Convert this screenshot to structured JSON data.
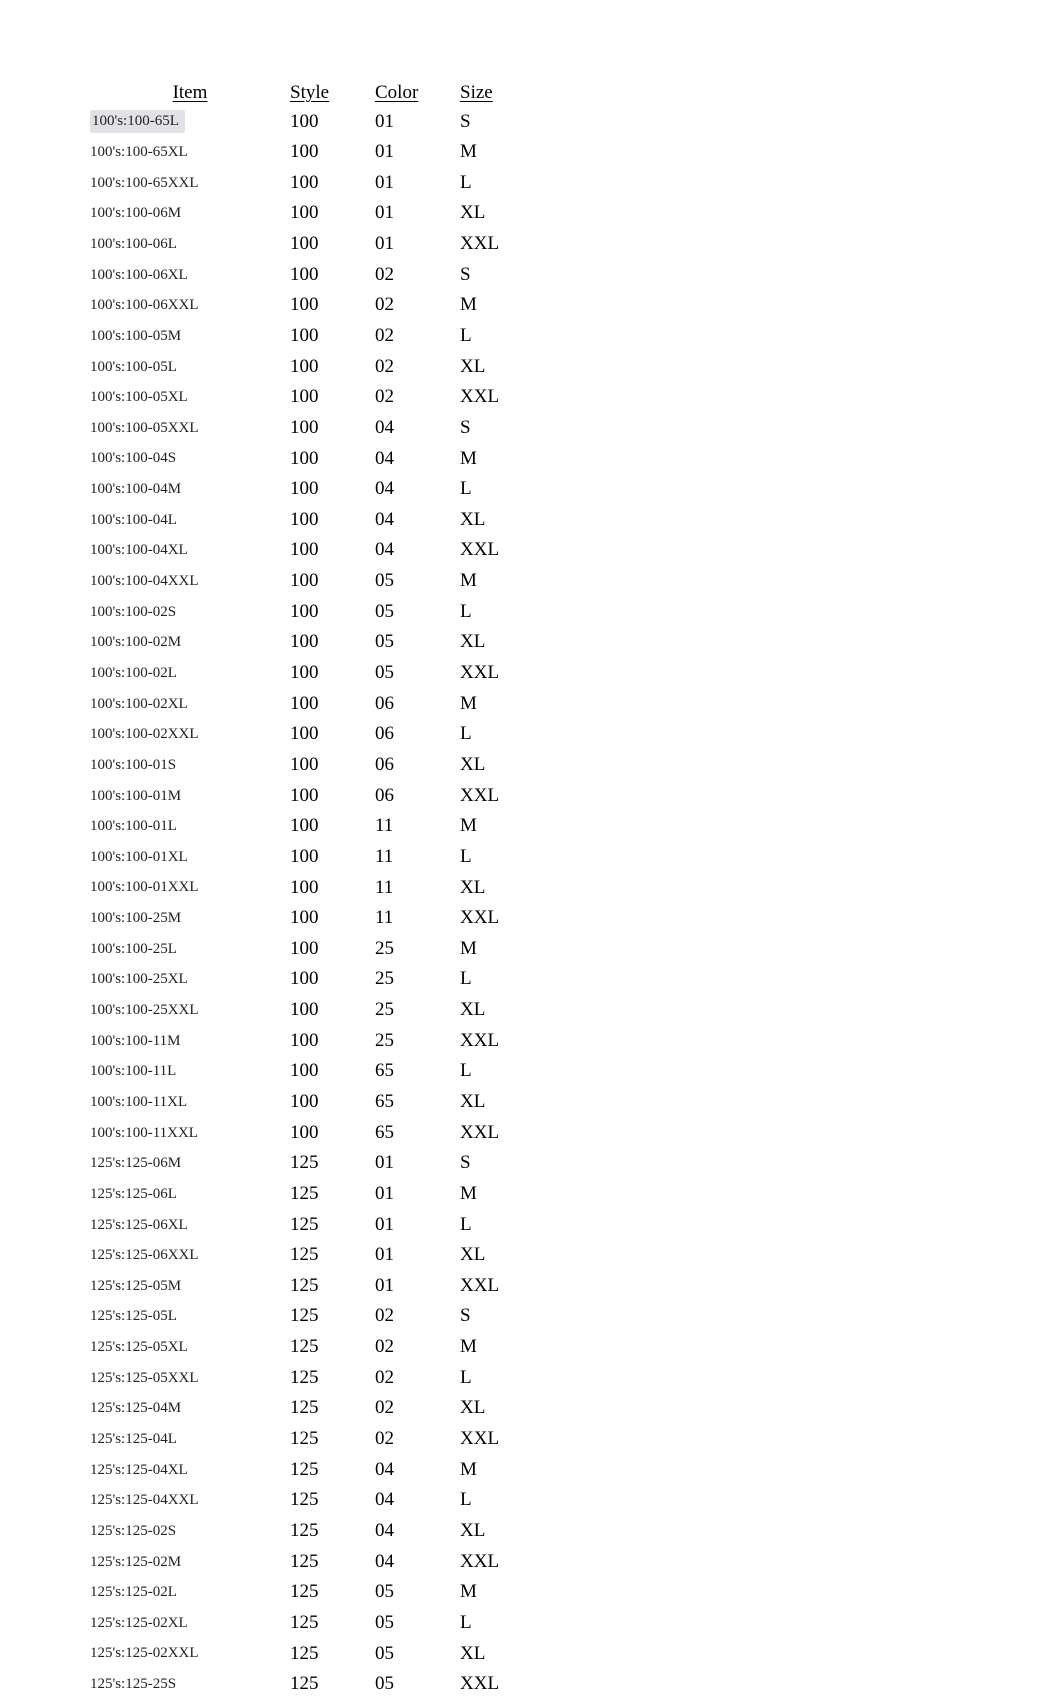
{
  "headers": {
    "item": "Item",
    "style": "Style",
    "color": "Color",
    "size": "Size"
  },
  "rows": [
    {
      "item": "100's:100-65L",
      "style": "100",
      "color": "01",
      "size": "S",
      "highlight": true
    },
    {
      "item": "100's:100-65XL",
      "style": "100",
      "color": "01",
      "size": "M"
    },
    {
      "item": "100's:100-65XXL",
      "style": "100",
      "color": "01",
      "size": "L"
    },
    {
      "item": "100's:100-06M",
      "style": "100",
      "color": "01",
      "size": "XL"
    },
    {
      "item": "100's:100-06L",
      "style": "100",
      "color": "01",
      "size": "XXL"
    },
    {
      "item": "100's:100-06XL",
      "style": "100",
      "color": "02",
      "size": "S"
    },
    {
      "item": "100's:100-06XXL",
      "style": "100",
      "color": "02",
      "size": "M"
    },
    {
      "item": "100's:100-05M",
      "style": "100",
      "color": "02",
      "size": "L"
    },
    {
      "item": "100's:100-05L",
      "style": "100",
      "color": "02",
      "size": "XL"
    },
    {
      "item": "100's:100-05XL",
      "style": "100",
      "color": "02",
      "size": "XXL"
    },
    {
      "item": "100's:100-05XXL",
      "style": "100",
      "color": "04",
      "size": "S"
    },
    {
      "item": "100's:100-04S",
      "style": "100",
      "color": "04",
      "size": "M"
    },
    {
      "item": "100's:100-04M",
      "style": "100",
      "color": "04",
      "size": "L"
    },
    {
      "item": "100's:100-04L",
      "style": "100",
      "color": "04",
      "size": "XL"
    },
    {
      "item": "100's:100-04XL",
      "style": "100",
      "color": "04",
      "size": "XXL"
    },
    {
      "item": "100's:100-04XXL",
      "style": "100",
      "color": "05",
      "size": "M"
    },
    {
      "item": "100's:100-02S",
      "style": "100",
      "color": "05",
      "size": "L"
    },
    {
      "item": "100's:100-02M",
      "style": "100",
      "color": "05",
      "size": "XL"
    },
    {
      "item": "100's:100-02L",
      "style": "100",
      "color": "05",
      "size": "XXL"
    },
    {
      "item": "100's:100-02XL",
      "style": "100",
      "color": "06",
      "size": "M"
    },
    {
      "item": "100's:100-02XXL",
      "style": "100",
      "color": "06",
      "size": "L"
    },
    {
      "item": "100's:100-01S",
      "style": "100",
      "color": "06",
      "size": "XL"
    },
    {
      "item": "100's:100-01M",
      "style": "100",
      "color": "06",
      "size": "XXL"
    },
    {
      "item": "100's:100-01L",
      "style": "100",
      "color": "11",
      "size": "M"
    },
    {
      "item": "100's:100-01XL",
      "style": "100",
      "color": "11",
      "size": "L"
    },
    {
      "item": "100's:100-01XXL",
      "style": "100",
      "color": "11",
      "size": "XL"
    },
    {
      "item": "100's:100-25M",
      "style": "100",
      "color": "11",
      "size": "XXL"
    },
    {
      "item": "100's:100-25L",
      "style": "100",
      "color": "25",
      "size": "M"
    },
    {
      "item": "100's:100-25XL",
      "style": "100",
      "color": "25",
      "size": "L"
    },
    {
      "item": "100's:100-25XXL",
      "style": "100",
      "color": "25",
      "size": "XL"
    },
    {
      "item": "100's:100-11M",
      "style": "100",
      "color": "25",
      "size": "XXL"
    },
    {
      "item": "100's:100-11L",
      "style": "100",
      "color": "65",
      "size": "L"
    },
    {
      "item": "100's:100-11XL",
      "style": "100",
      "color": "65",
      "size": "XL"
    },
    {
      "item": "100's:100-11XXL",
      "style": "100",
      "color": "65",
      "size": "XXL"
    },
    {
      "item": "125's:125-06M",
      "style": "125",
      "color": "01",
      "size": "S"
    },
    {
      "item": "125's:125-06L",
      "style": "125",
      "color": "01",
      "size": "M"
    },
    {
      "item": "125's:125-06XL",
      "style": "125",
      "color": "01",
      "size": "L"
    },
    {
      "item": "125's:125-06XXL",
      "style": "125",
      "color": "01",
      "size": "XL"
    },
    {
      "item": "125's:125-05M",
      "style": "125",
      "color": "01",
      "size": "XXL"
    },
    {
      "item": "125's:125-05L",
      "style": "125",
      "color": "02",
      "size": "S"
    },
    {
      "item": "125's:125-05XL",
      "style": "125",
      "color": "02",
      "size": "M"
    },
    {
      "item": "125's:125-05XXL",
      "style": "125",
      "color": "02",
      "size": "L"
    },
    {
      "item": "125's:125-04M",
      "style": "125",
      "color": "02",
      "size": "XL"
    },
    {
      "item": "125's:125-04L",
      "style": "125",
      "color": "02",
      "size": "XXL"
    },
    {
      "item": "125's:125-04XL",
      "style": "125",
      "color": "04",
      "size": "M"
    },
    {
      "item": "125's:125-04XXL",
      "style": "125",
      "color": "04",
      "size": "L"
    },
    {
      "item": "125's:125-02S",
      "style": "125",
      "color": "04",
      "size": "XL"
    },
    {
      "item": "125's:125-02M",
      "style": "125",
      "color": "04",
      "size": "XXL"
    },
    {
      "item": "125's:125-02L",
      "style": "125",
      "color": "05",
      "size": "M"
    },
    {
      "item": "125's:125-02XL",
      "style": "125",
      "color": "05",
      "size": "L"
    },
    {
      "item": "125's:125-02XXL",
      "style": "125",
      "color": "05",
      "size": "XL"
    },
    {
      "item": "125's:125-25S",
      "style": "125",
      "color": "05",
      "size": "XXL"
    }
  ]
}
